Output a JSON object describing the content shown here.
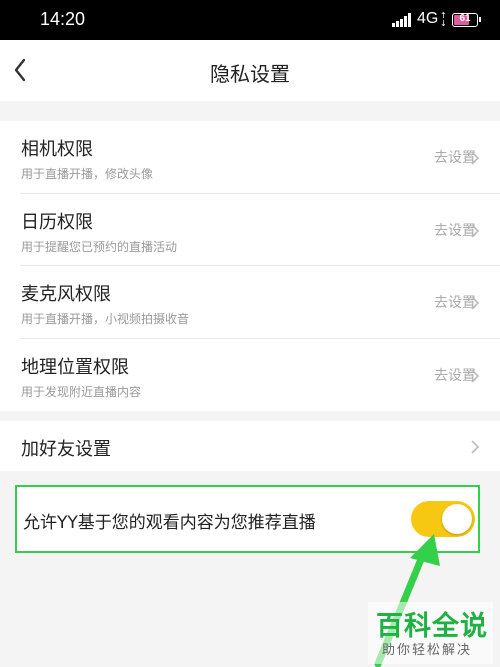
{
  "status_bar": {
    "time": "14:20",
    "network": "4G",
    "battery": "61",
    "battery_level": 0.61
  },
  "nav": {
    "title": "隐私设置",
    "back_icon": "chevron-left-icon"
  },
  "permissions": [
    {
      "title": "相机权限",
      "desc": "用于直播开播，修改头像",
      "action": "去设置"
    },
    {
      "title": "日历权限",
      "desc": "用于提醒您已预约的直播活动",
      "action": "去设置"
    },
    {
      "title": "麦克风权限",
      "desc": "用于直播开播，小视频拍摄收音",
      "action": "去设置"
    },
    {
      "title": "地理位置权限",
      "desc": "用于发现附近直播内容",
      "action": "去设置"
    }
  ],
  "friend_settings": {
    "title": "加好友设置"
  },
  "recommendation": {
    "title": "允许YY基于您的观看内容为您推荐直播",
    "enabled": true
  },
  "colors": {
    "toggle_on": "#f6c811",
    "highlight": "#35d04a",
    "arrow": "#35d04a",
    "watermark_green": "#1fb141"
  },
  "watermark": {
    "main": "百科全说",
    "sub": "助你轻松解决"
  }
}
